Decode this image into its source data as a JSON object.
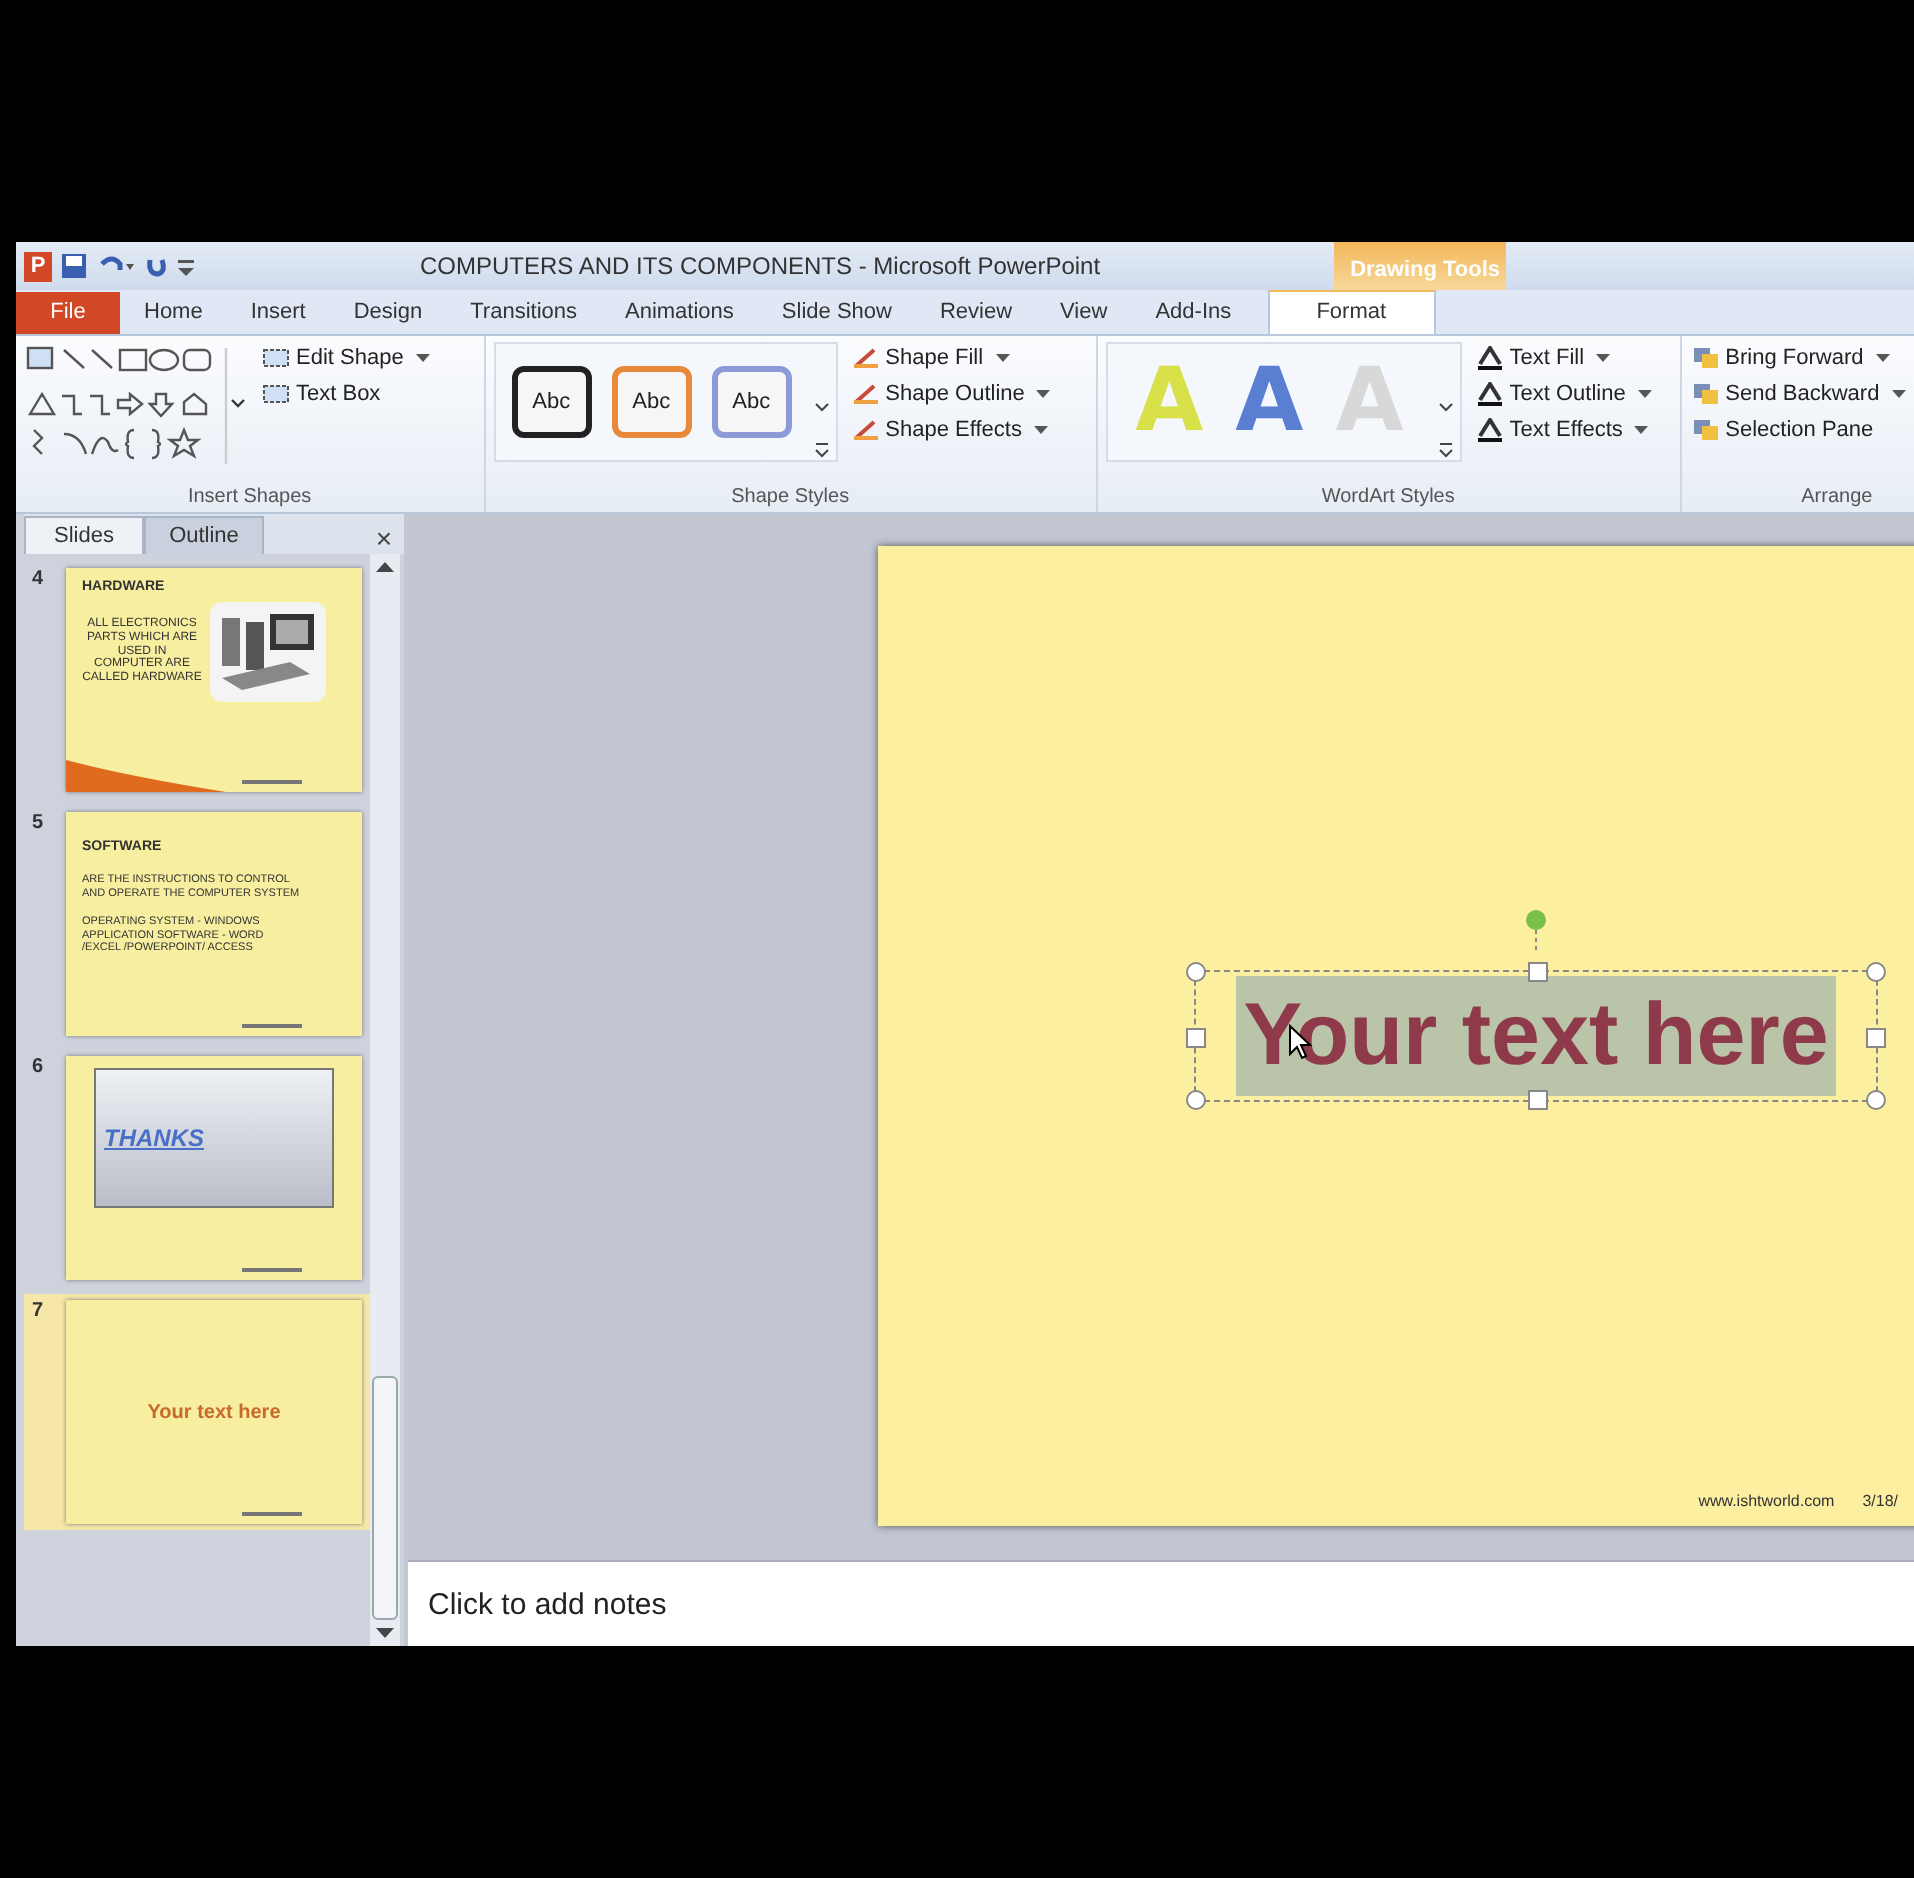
{
  "title_bar": {
    "app_letter": "P",
    "title": "COMPUTERS AND ITS COMPONENTS - Microsoft PowerPoint",
    "context_group": "Drawing Tools"
  },
  "ribbon_tabs": [
    {
      "label": "File",
      "kind": "file",
      "selected": false
    },
    {
      "label": "Home",
      "kind": "tab",
      "selected": false
    },
    {
      "label": "Insert",
      "kind": "tab",
      "selected": false
    },
    {
      "label": "Design",
      "kind": "tab",
      "selected": false
    },
    {
      "label": "Transitions",
      "kind": "tab",
      "selected": false
    },
    {
      "label": "Animations",
      "kind": "tab",
      "selected": false
    },
    {
      "label": "Slide Show",
      "kind": "tab",
      "selected": false
    },
    {
      "label": "Review",
      "kind": "tab",
      "selected": false
    },
    {
      "label": "View",
      "kind": "tab",
      "selected": false
    },
    {
      "label": "Add-Ins",
      "kind": "tab",
      "selected": false
    },
    {
      "label": "Format",
      "kind": "context",
      "selected": true
    }
  ],
  "insert_shapes": {
    "label": "Insert Shapes",
    "commands": [
      {
        "label": "Edit Shape",
        "has_menu": true
      },
      {
        "label": "Text Box",
        "has_menu": false
      }
    ]
  },
  "shape_styles": {
    "label": "Shape Styles",
    "presets": [
      {
        "text": "Abc",
        "color": "#222222"
      },
      {
        "text": "Abc",
        "color": "#e8893a"
      },
      {
        "text": "Abc",
        "color": "#8d9ad8"
      }
    ],
    "commands": [
      {
        "label": "Shape Fill",
        "has_menu": true
      },
      {
        "label": "Shape Outline",
        "has_menu": true
      },
      {
        "label": "Shape Effects",
        "has_menu": true
      }
    ]
  },
  "wordart_styles": {
    "label": "WordArt Styles",
    "presets": [
      {
        "text": "A",
        "color": "#d8e04a"
      },
      {
        "text": "A",
        "color": "#5a7fd2"
      },
      {
        "text": "A",
        "color": "#d8d8d8"
      }
    ],
    "commands": [
      {
        "label": "Text Fill",
        "has_menu": true
      },
      {
        "label": "Text Outline",
        "has_menu": true
      },
      {
        "label": "Text Effects",
        "has_menu": true
      }
    ]
  },
  "arrange": {
    "label": "Arrange",
    "commands": [
      {
        "label": "Bring Forward",
        "has_menu": true
      },
      {
        "label": "Send Backward",
        "has_menu": true
      },
      {
        "label": "Selection Pane",
        "has_menu": false
      }
    ]
  },
  "slides_panel": {
    "tabs": [
      {
        "label": "Slides",
        "selected": true
      },
      {
        "label": "Outline",
        "selected": false
      }
    ],
    "close": "×",
    "slides": [
      {
        "number": "4",
        "kind": "picture",
        "selected": false,
        "title": "HARDWARE",
        "paragraphs": [
          "ALL ELECTRONICS PARTS WHICH ARE USED IN COMPUTER ARE CALLED HARDWARE"
        ]
      },
      {
        "number": "5",
        "kind": "text",
        "selected": false,
        "title": "SOFTWARE",
        "paragraphs": [
          "ARE THE INSTRUCTIONS TO CONTROL AND OPERATE THE COMPUTER SYSTEM",
          "OPERATING SYSTEM - WINDOWS APPLICATION SOFTWARE - WORD /EXCEL /POWERPOINT/ ACCESS"
        ]
      },
      {
        "number": "6",
        "kind": "banner",
        "selected": false,
        "title": "THANKS"
      },
      {
        "number": "7",
        "kind": "center",
        "selected": true,
        "title": "Your text here"
      }
    ]
  },
  "slide": {
    "text": "Your text here",
    "footer_url": "www.ishtworld.com",
    "footer_date": "3/18/"
  },
  "notes": {
    "placeholder": "Click to add notes"
  }
}
